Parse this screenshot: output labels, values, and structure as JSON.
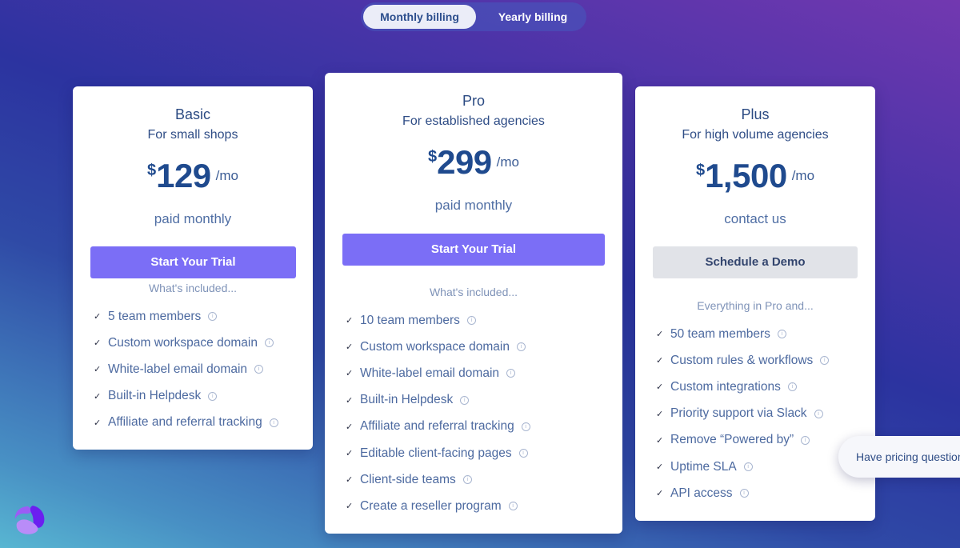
{
  "billing_toggle": {
    "options": [
      "Monthly billing",
      "Yearly billing"
    ],
    "selected": "Monthly billing"
  },
  "plans": [
    {
      "name": "Basic",
      "tagline": "For small shops",
      "currency": "$",
      "price": "129",
      "period": "/mo",
      "billing_note": "paid monthly",
      "cta": "Start Your Trial",
      "included_label": "What's included...",
      "features": [
        "5 team members",
        "Custom workspace domain",
        "White-label email domain",
        "Built-in Helpdesk",
        "Affiliate and referral tracking"
      ]
    },
    {
      "name": "Pro",
      "tagline": "For established agencies",
      "currency": "$",
      "price": "299",
      "period": "/mo",
      "billing_note": "paid monthly",
      "cta": "Start Your Trial",
      "included_label": "What's included...",
      "features": [
        "10 team members",
        "Custom workspace domain",
        "White-label email domain",
        "Built-in Helpdesk",
        "Affiliate and referral tracking",
        "Editable client-facing pages",
        "Client-side teams",
        "Create a reseller program"
      ]
    },
    {
      "name": "Plus",
      "tagline": "For high volume agencies",
      "currency": "$",
      "price": "1,500",
      "period": "/mo",
      "billing_note": "contact us",
      "cta": "Schedule a Demo",
      "included_label": "Everything in Pro and...",
      "features": [
        "50 team members",
        "Custom rules & workflows",
        "Custom integrations",
        "Priority support via Slack",
        "Remove “Powered by”",
        "Uptime SLA",
        "API access"
      ]
    }
  ],
  "icons": {
    "check": "✓",
    "info": "i"
  },
  "chat": {
    "label": "Have pricing questions?"
  },
  "colors": {
    "primary_button": "#7b6ef6",
    "secondary_button": "#e1e3e8",
    "price_text": "#1f4a8e"
  }
}
